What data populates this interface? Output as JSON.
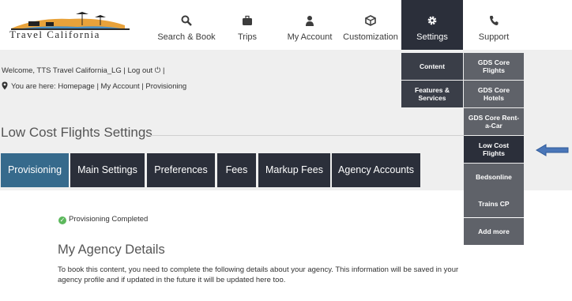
{
  "logo": {
    "text": "Travel California"
  },
  "nav": [
    {
      "label": "Search & Book",
      "icon": "search-icon"
    },
    {
      "label": "Trips",
      "icon": "briefcase-icon"
    },
    {
      "label": "My Account",
      "icon": "user-icon"
    },
    {
      "label": "Customization",
      "icon": "cube-icon"
    },
    {
      "label": "Settings",
      "icon": "gear-icon"
    },
    {
      "label": "Support",
      "icon": "phone-icon"
    }
  ],
  "welcome": "Welcome, TTS Travel California_LG  |  Log out ⏻  |",
  "breadcrumb": "You are here: Homepage | My Account | Provisioning",
  "page_title": "Low Cost Flights Settings",
  "tabs": [
    "Provisioning",
    "Main Settings",
    "Preferences",
    "Fees",
    "Markup Fees",
    "Agency Accounts"
  ],
  "status": "Provisioning Completed",
  "section_title": "My Agency Details",
  "description": "To book this content, you need to complete the following details about your agency. This information will be saved in your agency profile and if updated in the future it will be updated here too.",
  "settings_menu": {
    "col1": [
      "Content",
      "Features & Services"
    ],
    "col2": [
      "GDS Core Flights",
      "GDS Core Hotels",
      "GDS Core Rent-a-Car",
      "Low Cost Flights",
      "Bedsonline",
      "Trains CP",
      "Add more"
    ]
  },
  "colors": {
    "dark": "#2b2f3a",
    "active_tab": "#366a8c",
    "submenu_gray": "#5f6269",
    "arrow": "#4a76b8"
  }
}
